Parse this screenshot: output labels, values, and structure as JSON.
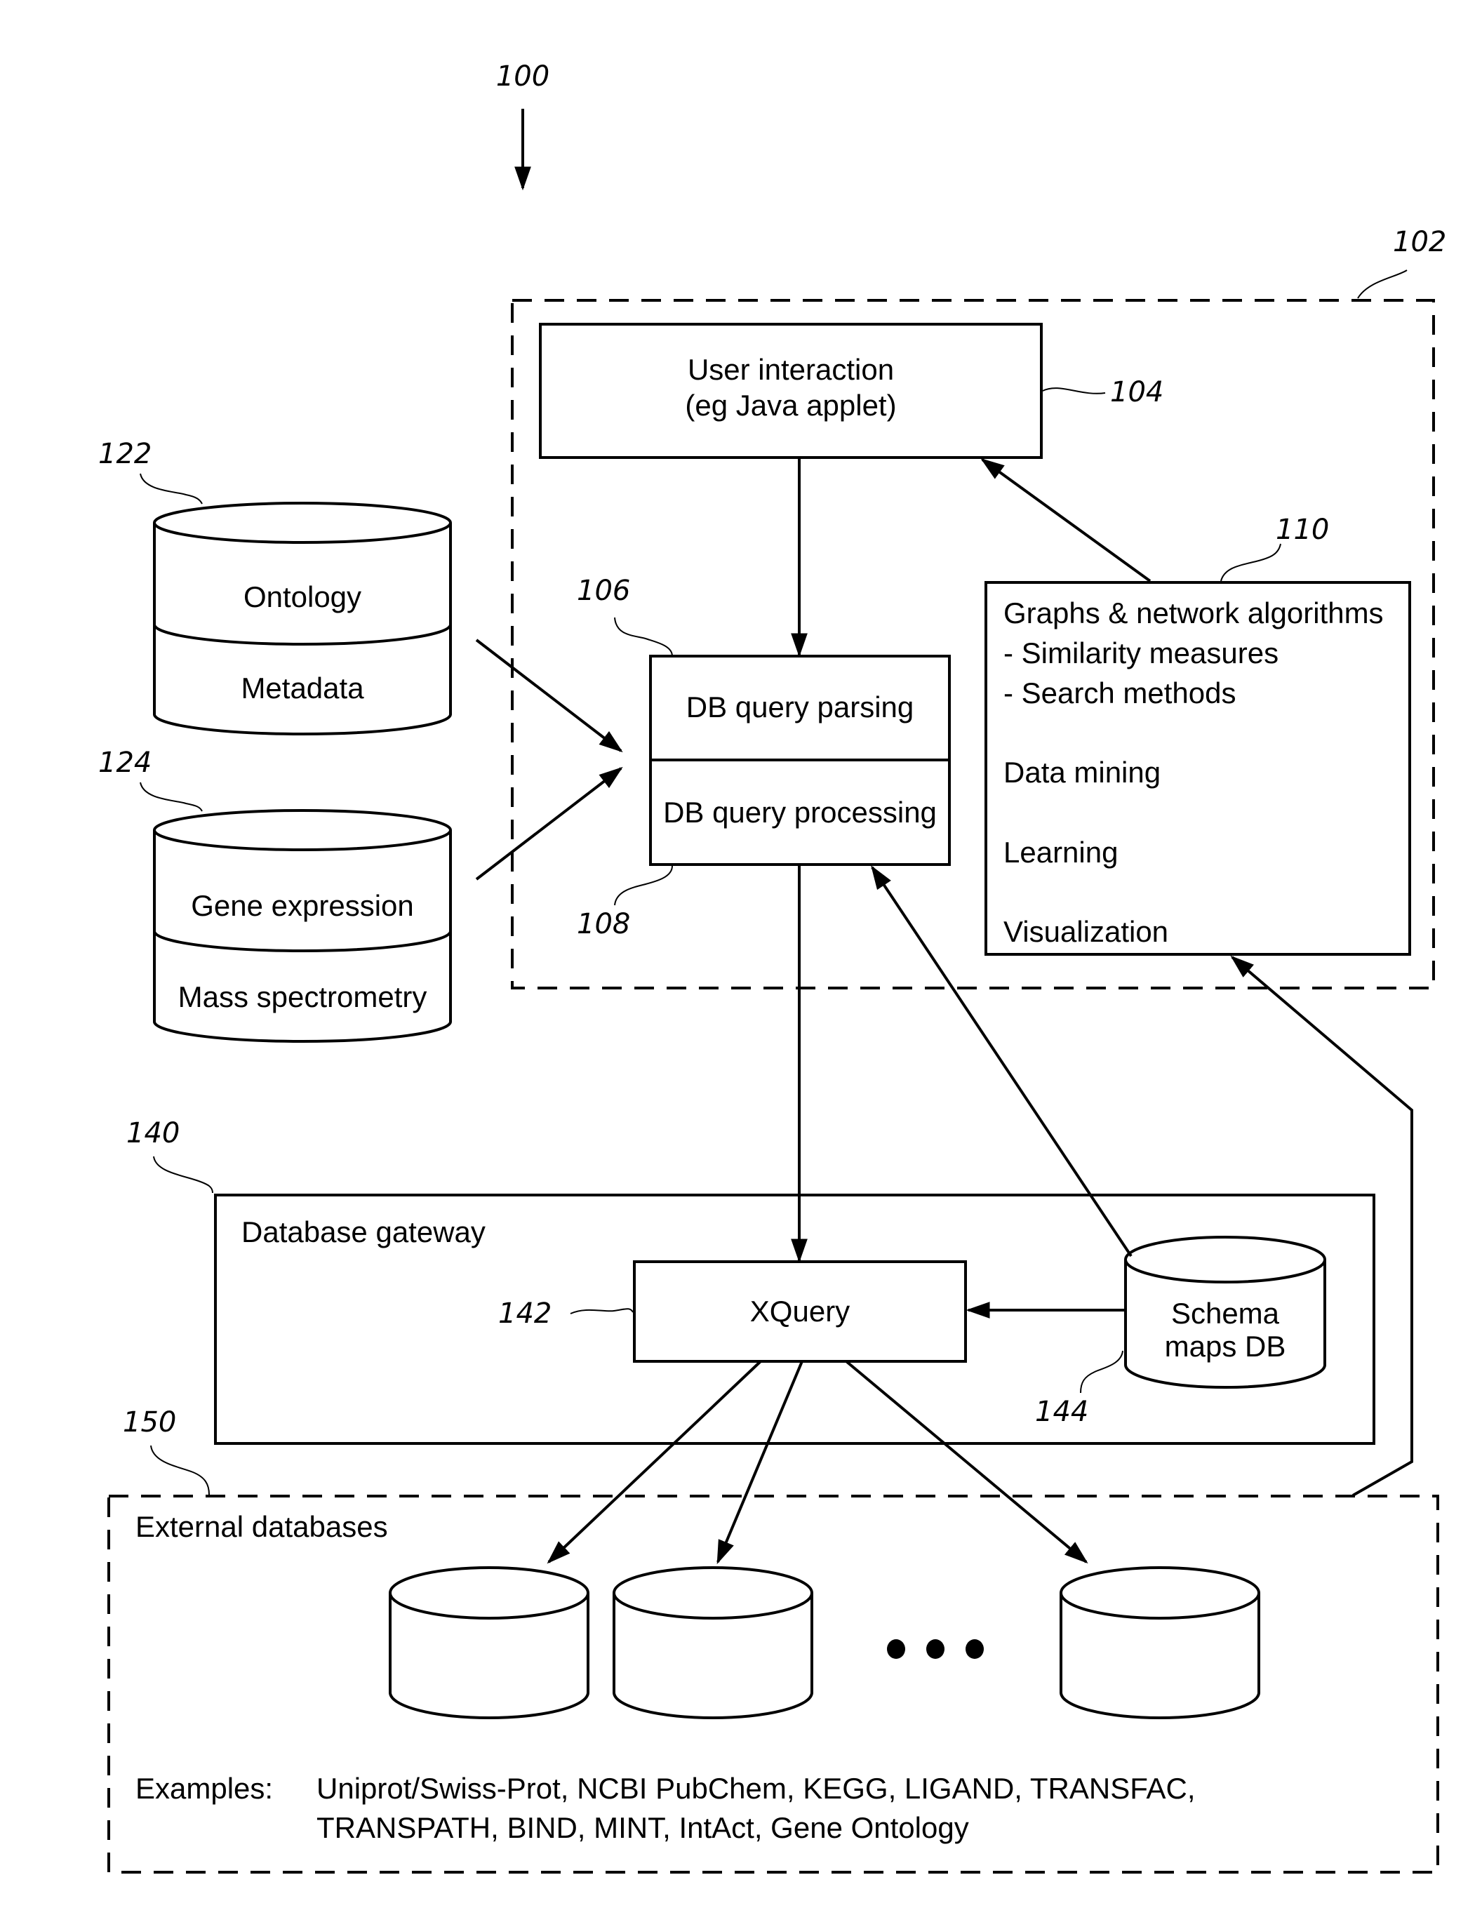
{
  "figure": {
    "ref_main": "100",
    "system": {
      "ref": "102",
      "user_interaction": {
        "ref": "104",
        "line1": "User interaction",
        "line2": "(eg Java applet)"
      },
      "query_box": {
        "ref_parsing": "106",
        "ref_processing": "108",
        "parsing": "DB query parsing",
        "processing": "DB query processing"
      },
      "algorithms": {
        "ref": "110",
        "lines": [
          "Graphs & network algorithms",
          "- Similarity measures",
          "- Search methods",
          "Data mining",
          "Learning",
          "Visualization"
        ]
      }
    },
    "local_dbs": [
      {
        "ref": "122",
        "top": "Ontology",
        "bottom": "Metadata"
      },
      {
        "ref": "124",
        "top": "Gene expression",
        "bottom": "Mass spectrometry"
      }
    ],
    "gateway": {
      "ref": "140",
      "title": "Database gateway",
      "xquery": {
        "ref": "142",
        "label": "XQuery"
      },
      "schema": {
        "ref": "144",
        "line1": "Schema",
        "line2": "maps DB"
      }
    },
    "external": {
      "ref": "150",
      "title": "External databases",
      "examples_label": "Examples:",
      "examples_line1": "Uniprot/Swiss-Prot, NCBI PubChem, KEGG, LIGAND, TRANSFAC,",
      "examples_line2": "TRANSPATH, BIND, MINT, IntAct, Gene Ontology"
    }
  }
}
